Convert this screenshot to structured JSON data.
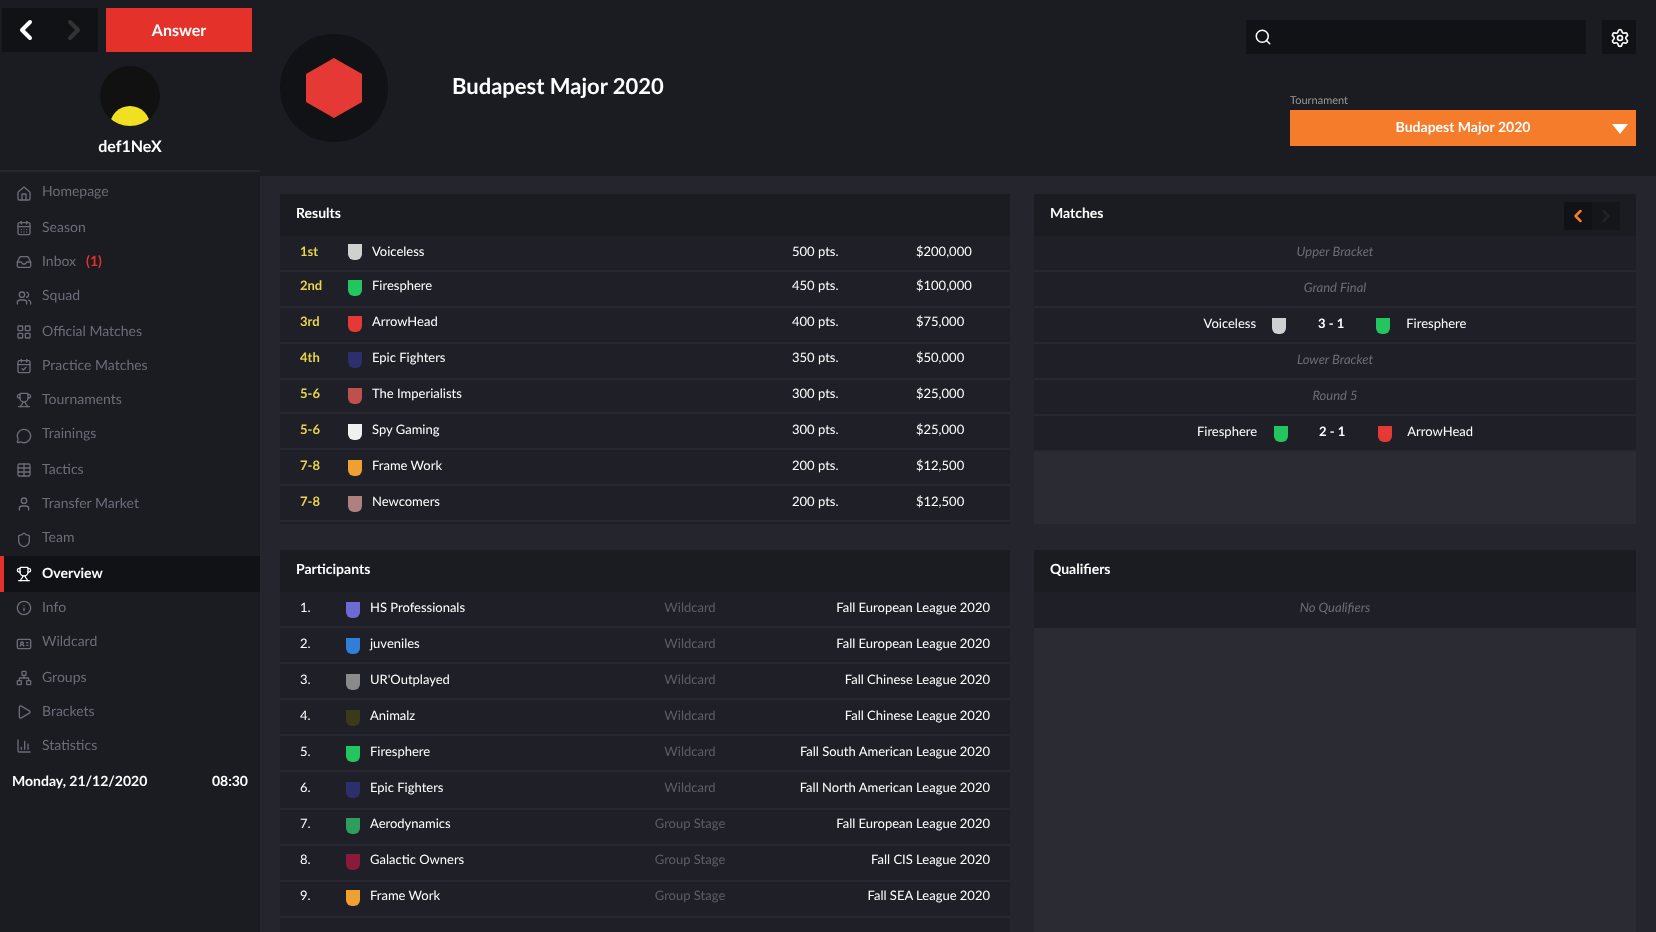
{
  "top_bar": {
    "answer_button": "Answer"
  },
  "profile": {
    "username": "def1NeX"
  },
  "nav": [
    {
      "label": "Homepage",
      "selected": false
    },
    {
      "label": "Season",
      "selected": false
    },
    {
      "label": "Inbox",
      "badge": "(1)",
      "selected": false
    },
    {
      "label": "Squad",
      "selected": false
    },
    {
      "label": "Official Matches",
      "selected": false
    },
    {
      "label": "Practice Matches",
      "selected": false
    },
    {
      "label": "Tournaments",
      "selected": false
    },
    {
      "label": "Trainings",
      "selected": false
    },
    {
      "label": "Tactics",
      "selected": false
    },
    {
      "label": "Transfer Market",
      "selected": false
    },
    {
      "label": "Team",
      "selected": false
    },
    {
      "label": "Overview",
      "selected": true
    },
    {
      "label": "Info",
      "selected": false
    },
    {
      "label": "Wildcard",
      "selected": false
    },
    {
      "label": "Groups",
      "selected": false
    },
    {
      "label": "Brackets",
      "selected": false
    },
    {
      "label": "Statistics",
      "selected": false
    }
  ],
  "footer": {
    "date": "Monday, 21/12/2020",
    "time": "08:30"
  },
  "header": {
    "title": "Budapest Major 2020",
    "dropdown_label": "Tournament",
    "dropdown_value": "Budapest Major 2020"
  },
  "results": {
    "title": "Results",
    "rows": [
      {
        "place": "1st",
        "team": "Voiceless",
        "color": "#d0d0d0",
        "points": "500 pts.",
        "prize": "$200,000"
      },
      {
        "place": "2nd",
        "team": "Firesphere",
        "color": "#22c55e",
        "points": "450 pts.",
        "prize": "$100,000"
      },
      {
        "place": "3rd",
        "team": "ArrowHead",
        "color": "#e53935",
        "points": "400 pts.",
        "prize": "$75,000"
      },
      {
        "place": "4th",
        "team": "Epic Fighters",
        "color": "#2b2f6b",
        "points": "350 pts.",
        "prize": "$50,000"
      },
      {
        "place": "5-6",
        "team": "The Imperialists",
        "color": "#c0504d",
        "points": "300 pts.",
        "prize": "$25,000"
      },
      {
        "place": "5-6",
        "team": "Spy Gaming",
        "color": "#f0f0f0",
        "points": "300 pts.",
        "prize": "$25,000"
      },
      {
        "place": "7-8",
        "team": "Frame Work",
        "color": "#f0a030",
        "points": "200 pts.",
        "prize": "$12,500"
      },
      {
        "place": "7-8",
        "team": "Newcomers",
        "color": "#b08080",
        "points": "200 pts.",
        "prize": "$12,500"
      }
    ]
  },
  "matches": {
    "title": "Matches",
    "rows": [
      {
        "kind": "heading",
        "text": "Upper Bracket"
      },
      {
        "kind": "heading",
        "text": "Grand Final"
      },
      {
        "kind": "match",
        "home": {
          "team": "Voiceless",
          "color": "#d0d0d0"
        },
        "score": "3 - 1",
        "away": {
          "team": "Firesphere",
          "color": "#22c55e"
        }
      },
      {
        "kind": "heading",
        "text": "Lower Bracket"
      },
      {
        "kind": "heading",
        "text": "Round 5"
      },
      {
        "kind": "match",
        "home": {
          "team": "Firesphere",
          "color": "#22c55e"
        },
        "score": "2 - 1",
        "away": {
          "team": "ArrowHead",
          "color": "#e53935"
        }
      }
    ]
  },
  "participants": {
    "title": "Participants",
    "rows": [
      {
        "number": "1.",
        "team": "HS Professionals",
        "color": "#6b6bd6",
        "stage": "Wildcard",
        "league": "Fall European League 2020"
      },
      {
        "number": "2.",
        "team": "juveniles",
        "color": "#2f7fd8",
        "stage": "Wildcard",
        "league": "Fall European League 2020"
      },
      {
        "number": "3.",
        "team": "UR'Outplayed",
        "color": "#8a8a8a",
        "stage": "Wildcard",
        "league": "Fall Chinese League 2020"
      },
      {
        "number": "4.",
        "team": "Animalz",
        "color": "#3a3a1a",
        "stage": "Wildcard",
        "league": "Fall Chinese League 2020"
      },
      {
        "number": "5.",
        "team": "Firesphere",
        "color": "#22c55e",
        "stage": "Wildcard",
        "league": "Fall South American League 2020"
      },
      {
        "number": "6.",
        "team": "Epic Fighters",
        "color": "#2b2f6b",
        "stage": "Wildcard",
        "league": "Fall North American League 2020"
      },
      {
        "number": "7.",
        "team": "Aerodynamics",
        "color": "#2e9e5e",
        "stage": "Group Stage",
        "league": "Fall European League 2020"
      },
      {
        "number": "8.",
        "team": "Galactic Owners",
        "color": "#8b1a3a",
        "stage": "Group Stage",
        "league": "Fall CIS League 2020"
      },
      {
        "number": "9.",
        "team": "Frame Work",
        "color": "#f0a030",
        "stage": "Group Stage",
        "league": "Fall SEA League 2020"
      }
    ]
  },
  "qualifiers": {
    "title": "Qualifiers",
    "empty_text": "No Qualifiers"
  }
}
